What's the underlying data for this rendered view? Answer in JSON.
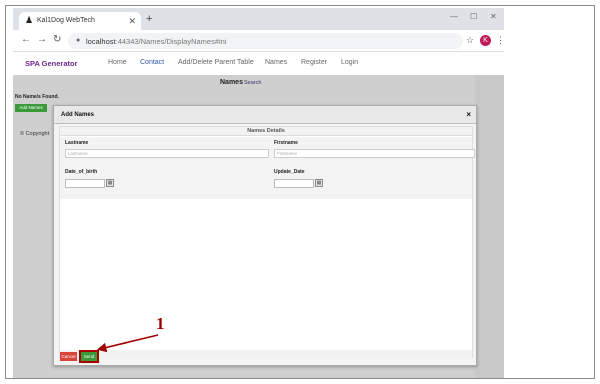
{
  "browser": {
    "tab_title": "Kal1Dog WebTech",
    "new_tab_symbol": "+",
    "tab_close_symbol": "✕",
    "window_controls": [
      "—",
      "☐",
      "✕"
    ],
    "url_host": "localhost",
    "url_rest": ":44343/Names/DisplayNames#ini",
    "profile_initial": "K"
  },
  "nav": {
    "brand": "SPA Generator",
    "links": [
      "Home",
      "Contact",
      "Add/Delete Parent Table",
      "Names",
      "Register",
      "Login"
    ],
    "active_index": 1
  },
  "page": {
    "title": "Names",
    "search_link": "Search",
    "no_names": "No Name/s Found.",
    "add_names_button": "Add Names",
    "copyright": "© Copyright"
  },
  "modal": {
    "title": "Add Names",
    "close_symbol": "×",
    "section": "Names Details",
    "fields": {
      "lastname_label": "Lastname",
      "lastname_placeholder": "Lastname",
      "firstname_label": "Firstname",
      "firstname_placeholder": "Firstname",
      "dob_label": "Date_of_birth",
      "update_label": "Update_Date"
    },
    "cancel_button": "Cancel",
    "send_button": "Send"
  },
  "annotation": {
    "callout_number": "1",
    "accent_color": "#a00000"
  }
}
